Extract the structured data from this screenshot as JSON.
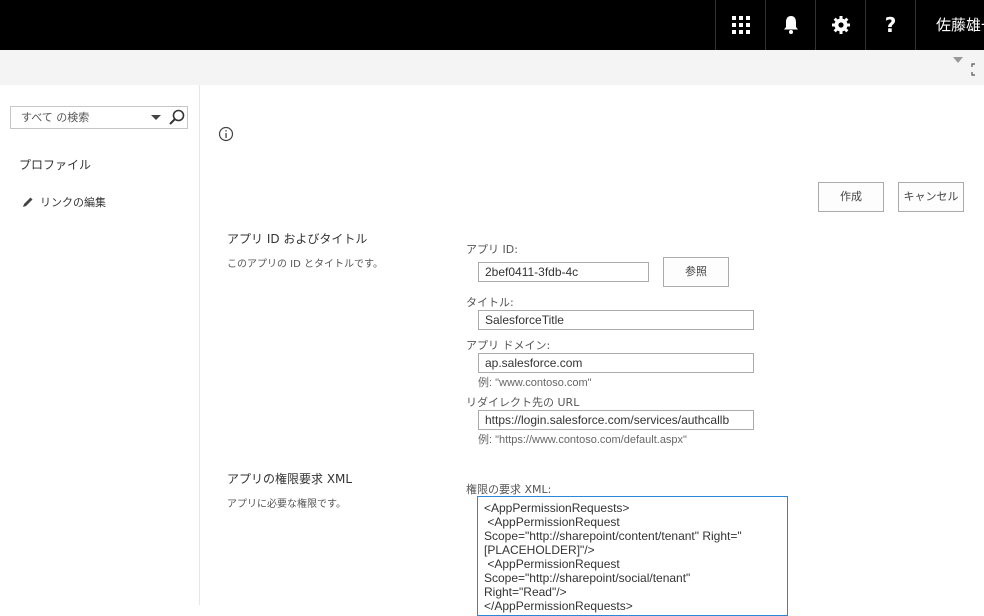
{
  "topbar": {
    "icons": [
      "app-launcher-icon",
      "bell-icon",
      "gear-icon",
      "question-icon"
    ],
    "user_name": "佐藤雄一"
  },
  "search": {
    "placeholder": "すべて の検索"
  },
  "leftnav": {
    "profile": "プロファイル",
    "edit_links": "リンクの編集"
  },
  "actions": {
    "create": "作成",
    "cancel": "キャンセル"
  },
  "section_app": {
    "title": "アプリ ID およびタイトル",
    "desc": "このアプリの ID とタイトルです。"
  },
  "fields": {
    "app_id_label": "アプリ ID:",
    "app_id_value": "2bef0411-3fdb-4c",
    "lookup": "参照",
    "title_label": "タイトル:",
    "title_value": "SalesforceTitle",
    "domain_label": "アプリ ドメイン:",
    "domain_value": "ap.salesforce.com",
    "domain_example": "例: \"www.contoso.com\"",
    "redirect_label": "リダイレクト先の URL",
    "redirect_value": "https://login.salesforce.com/services/authcallb",
    "redirect_example": "例: \"https://www.contoso.com/default.aspx\""
  },
  "section_perm": {
    "title": "アプリの権限要求 XML",
    "desc": "アプリに必要な権限です。"
  },
  "perm": {
    "label": "権限の要求 XML:",
    "lines": [
      "<AppPermissionRequests>",
      " <AppPermissionRequest",
      "Scope=\"http://sharepoint/content/tenant\" Right=\"",
      "[PLACEHOLDER]\"/>",
      " <AppPermissionRequest",
      "Scope=\"http://sharepoint/social/tenant\"",
      "Right=\"Read\"/>",
      "</AppPermissionRequests>"
    ]
  }
}
